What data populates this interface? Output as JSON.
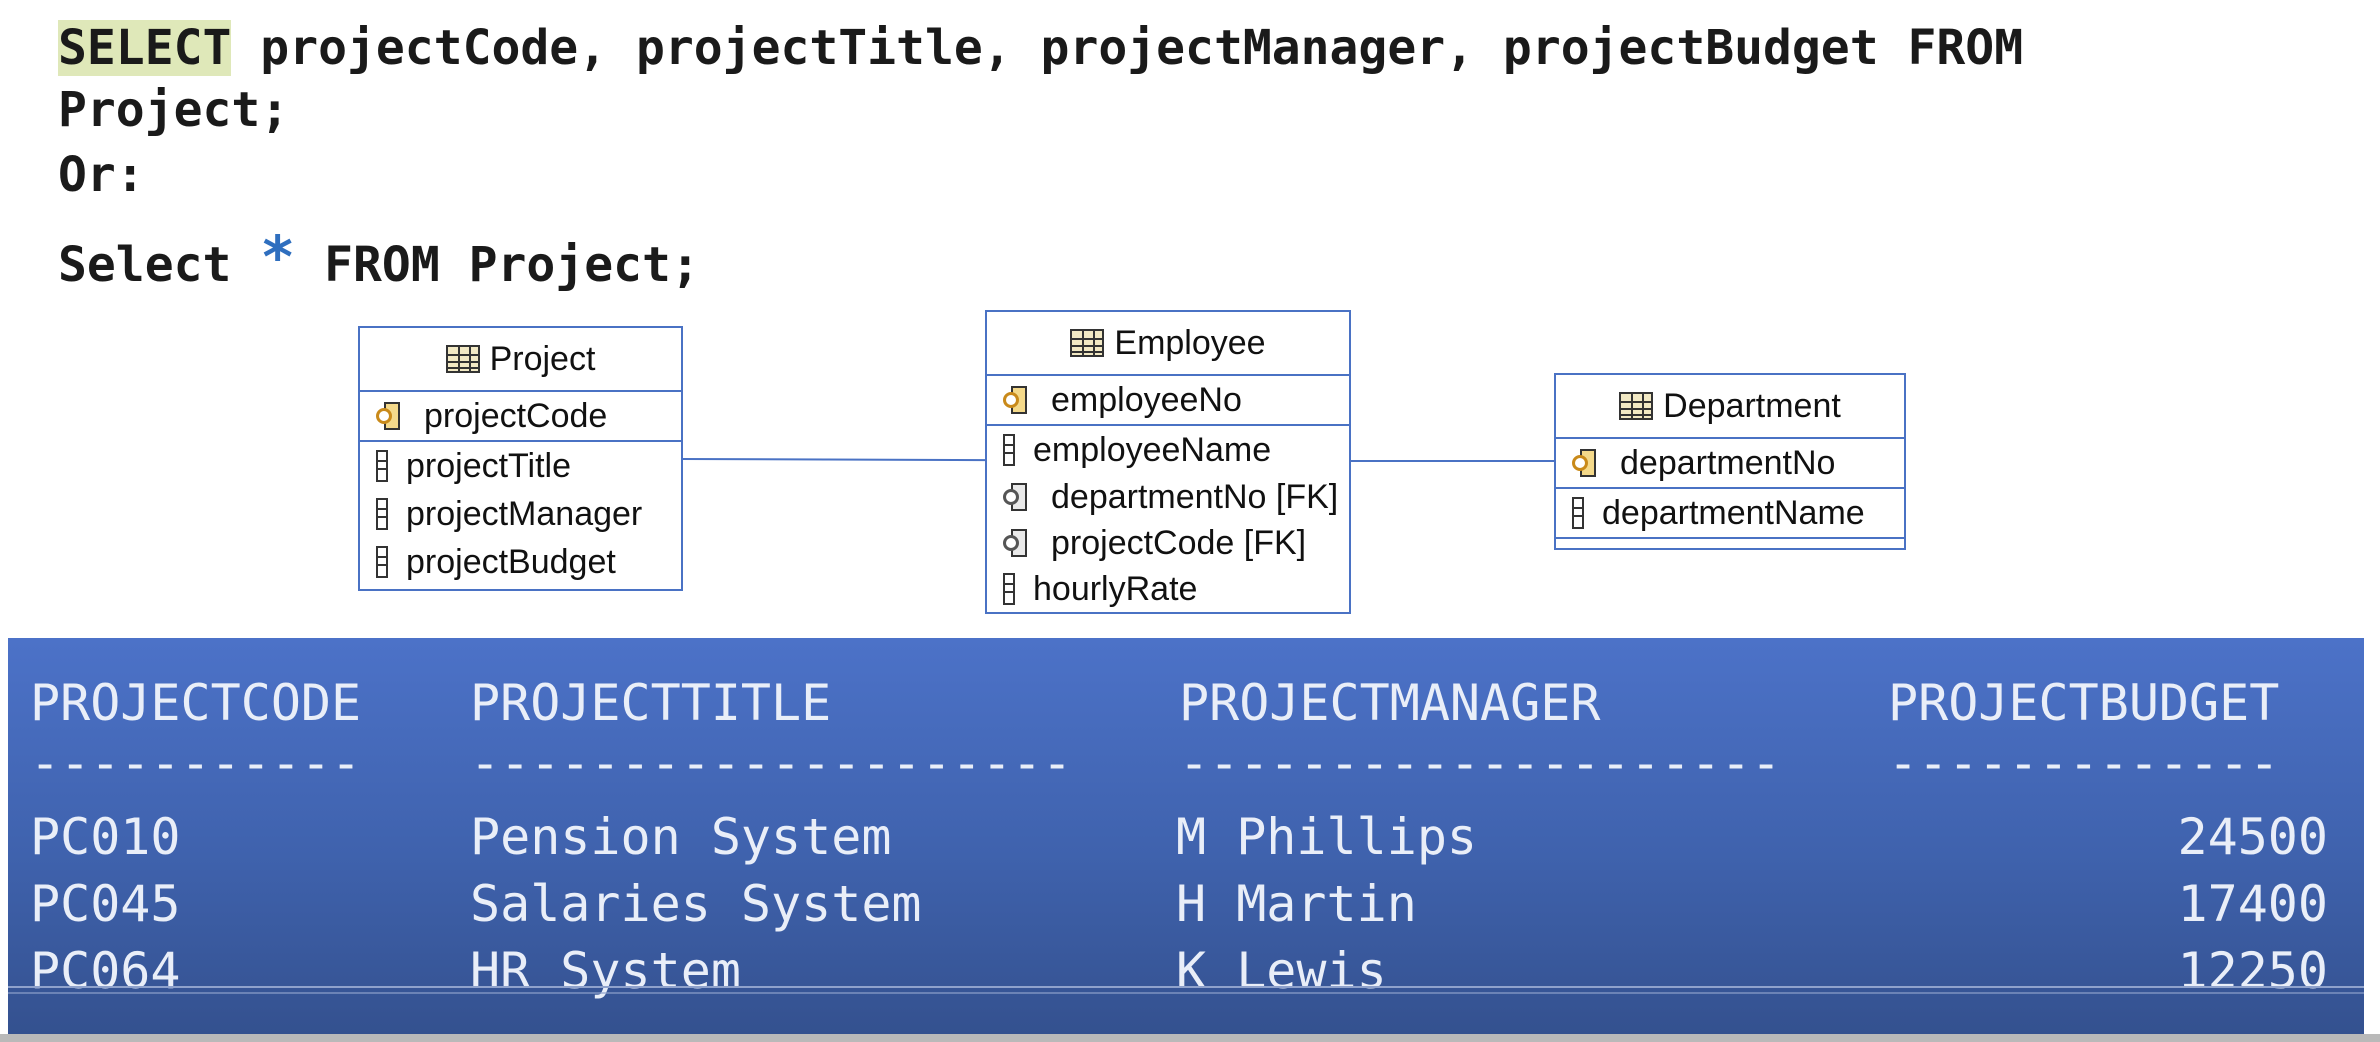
{
  "sql": {
    "line1_keyword": "SELECT",
    "line1_rest": " projectCode, projectTitle, projectManager, projectBudget FROM",
    "line2": "Project;",
    "line3": "Or:",
    "line4_start": "Select ",
    "line4_star": "*",
    "line4_end": " FROM Project;"
  },
  "entities": {
    "project": {
      "name": "Project",
      "pk": "projectCode",
      "columns": [
        "projectTitle",
        "projectManager",
        "projectBudget"
      ]
    },
    "employee": {
      "name": "Employee",
      "pk": "employeeNo",
      "columns": [
        "employeeName",
        "departmentNo [FK]",
        "projectCode [FK]",
        "hourlyRate"
      ]
    },
    "department": {
      "name": "Department",
      "pk": "departmentNo",
      "columns": [
        "departmentName"
      ]
    }
  },
  "result": {
    "headers": [
      "PROJECTCODE",
      "PROJECTTITLE",
      "PROJECTMANAGER",
      "PROJECTBUDGET"
    ],
    "dashes": [
      "-----------",
      "--------------------",
      "--------------------",
      "-------------"
    ],
    "rows": [
      [
        "PC010",
        "Pension System",
        "M Phillips",
        "24500"
      ],
      [
        "PC045",
        "Salaries System",
        "H Martin",
        "17400"
      ],
      [
        "PC064",
        "HR System",
        "K Lewis",
        "12250"
      ]
    ]
  }
}
